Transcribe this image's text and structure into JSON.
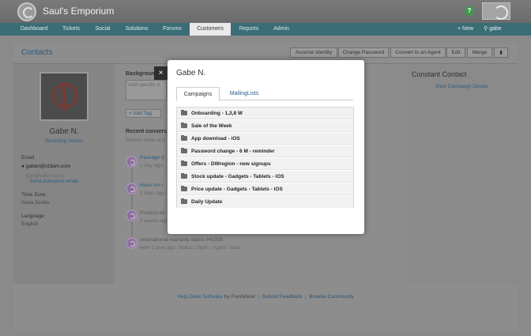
{
  "header": {
    "brand": "Saul's Emporium",
    "help_icon": "?"
  },
  "nav": {
    "items": [
      "Dashboard",
      "Tickets",
      "Social",
      "Solutions",
      "Forums",
      "Customers",
      "Reports",
      "Admin"
    ],
    "active": "Customers",
    "new_label": "New",
    "search_value": "gabe"
  },
  "contacts": {
    "title": "Contacts"
  },
  "actions": [
    "Assume Identity",
    "Change Password",
    "Convert to an Agent",
    "Edit",
    "Merge"
  ],
  "profile": {
    "name": "Gabe N.",
    "company": "Steaming Valves",
    "email_label": "Email",
    "email_primary": "gaben@st3am.com",
    "email_secondary": "gbn@valv0.co.ie",
    "send_activation": "Send activation email",
    "timezone_label": "Time Zone",
    "timezone": "Nova Scotia",
    "language_label": "Language",
    "language": "English"
  },
  "main": {
    "background_label": "Backgroun",
    "background_placeholder": "Add specific n",
    "add_tag": "Add Tag",
    "recent_label": "Recent convers",
    "recent_sub": "Recent ticket and",
    "timeline": [
      {
        "title": "Package d",
        "meta": "1 day ago,"
      },
      {
        "title": "Have not r",
        "meta": "2 days ago,"
      },
      {
        "title": "Product de",
        "meta": "2 weeks ago"
      },
      {
        "title": "International warranty status #41928",
        "meta": "over 1 year ago, Status: Open · Agent: Saul"
      }
    ]
  },
  "right": {
    "title": "Constant Contact",
    "link": "View Campaign Details"
  },
  "footer": {
    "helpdesk": "Help Desk Software",
    "by": "by Freshdesk",
    "submit": "Submit Feedback",
    "browse": "Browse Community"
  },
  "modal": {
    "close": "×",
    "title": "Gabe N.",
    "tabs": [
      "Campaigns",
      "MailingLists"
    ],
    "active_tab": "Campaigns",
    "campaigns": [
      "Onboarding - 1,3,8 W",
      "Sale of the Week",
      "App download - iOS",
      "Password change - 6 M - reminder",
      "Offers - DWregion - new signups",
      "Stock update - Gadgets - Tablets - iOS",
      "Price update - Gadgets - Tablets - iOS",
      "Daily Update"
    ]
  }
}
